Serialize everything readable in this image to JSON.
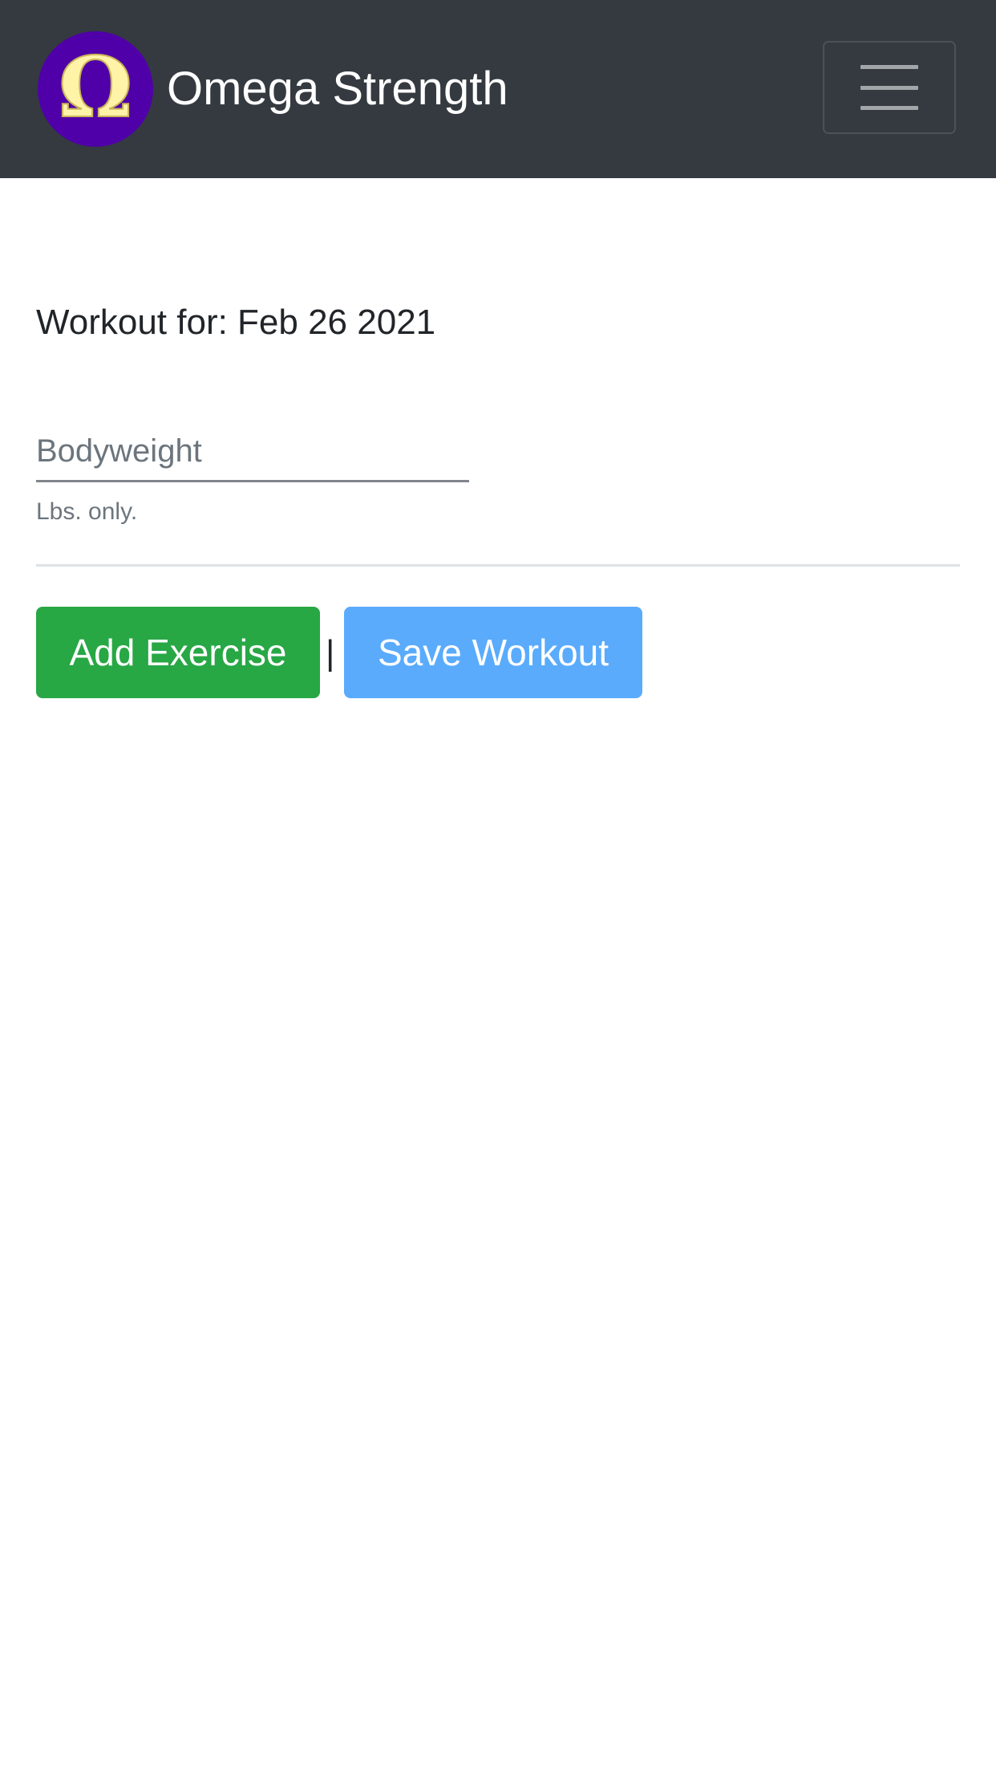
{
  "navbar": {
    "brand_name": "Omega Strength",
    "logo_glyph": "Ω",
    "logo_icon": "omega-logo-icon",
    "menu_icon": "hamburger-menu-icon",
    "colors": {
      "background": "#343a40",
      "logo_circle": "#5000a8",
      "logo_glyph": "#fff3a8"
    }
  },
  "main": {
    "workout_title": "Workout for: Feb 26 2021",
    "bodyweight": {
      "placeholder": "Bodyweight",
      "value": "",
      "help": "Lbs. only."
    },
    "actions": {
      "add_exercise_label": "Add Exercise",
      "separator": "|",
      "save_workout_label": "Save Workout"
    },
    "colors": {
      "add_button": "#28a745",
      "save_button": "#5aabfc"
    }
  }
}
